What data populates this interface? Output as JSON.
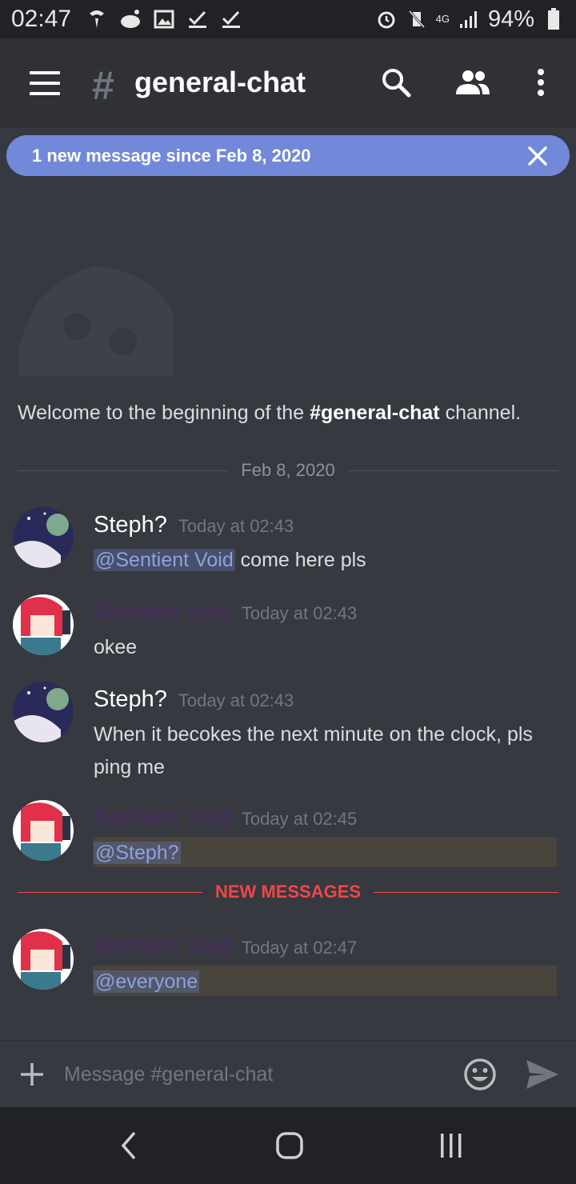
{
  "status_bar": {
    "time": "02:47",
    "network": "4G",
    "battery": "94%"
  },
  "header": {
    "channel_hash": "#",
    "channel_name": "general-chat"
  },
  "banner": {
    "text": "1 new message since Feb 8, 2020"
  },
  "welcome": {
    "prefix": "Welcome to the beginning of the ",
    "channel": "#general-chat",
    "suffix": " channel."
  },
  "date_divider": "Feb 8, 2020",
  "new_messages_divider": "NEW MESSAGES",
  "messages": [
    {
      "author": "Steph?",
      "time": "Today at 02:43",
      "mention": "@Sentient Void",
      "text": " come here pls"
    },
    {
      "author": "Sentient Void",
      "time": "Today at 02:43",
      "text": "okee"
    },
    {
      "author": "Steph?",
      "time": "Today at 02:43",
      "text": "When it becokes the next minute on the clock, pls ping me"
    },
    {
      "author": "Sentient Void",
      "time": "Today at 02:45",
      "mention": "@Steph?"
    },
    {
      "author": "Sentient Void",
      "time": "Today at 02:47",
      "mention": "@everyone"
    }
  ],
  "input": {
    "placeholder": "Message #general-chat"
  },
  "colors": {
    "background": "#36393f",
    "header": "#2f3136",
    "banner": "#7289da",
    "new_messages": "#f04747",
    "mention_highlight": "#49443c"
  }
}
